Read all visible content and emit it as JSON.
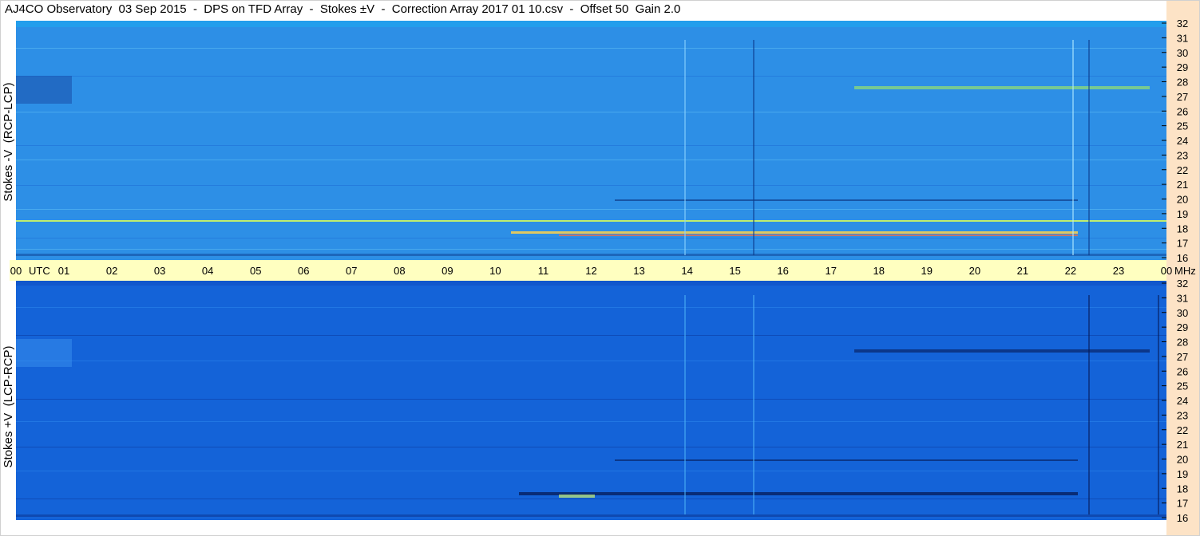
{
  "title": "AJ4CO Observatory  03 Sep 2015  -  DPS on TFD Array  -  Stokes ±V  -  Correction Array 2017 01 10.csv  -  Offset 50  Gain 2.0",
  "colors": {
    "top_panel": "#2d8fe6",
    "bottom_panel": "#1463d8",
    "time_axis_band": "#ffffc0",
    "freq_axis_band": "#fde3c6"
  },
  "chart_data": [
    {
      "type": "heatmap",
      "panel": "top",
      "ylabel": "Stokes -V  (RCP-LCP)",
      "x_ticks": [
        "00",
        "01",
        "02",
        "03",
        "04",
        "05",
        "06",
        "07",
        "08",
        "09",
        "10",
        "11",
        "12",
        "13",
        "14",
        "15",
        "16",
        "17",
        "18",
        "19",
        "20",
        "21",
        "22",
        "23",
        "00"
      ],
      "x_unit": "UTC",
      "xlim": [
        0,
        24
      ],
      "y_ticks": [
        32,
        31,
        30,
        29,
        28,
        27,
        26,
        25,
        24,
        23,
        22,
        21,
        20,
        19,
        18,
        17,
        16
      ],
      "y_unit": "MHz",
      "ylim": [
        16,
        32
      ]
    },
    {
      "type": "heatmap",
      "panel": "bottom",
      "ylabel": "Stokes +V  (LCP-RCP)",
      "x_ticks": [
        "00",
        "01",
        "02",
        "03",
        "04",
        "05",
        "06",
        "07",
        "08",
        "09",
        "10",
        "11",
        "12",
        "13",
        "14",
        "15",
        "16",
        "17",
        "18",
        "19",
        "20",
        "21",
        "22",
        "23",
        "00"
      ],
      "x_unit": "UTC",
      "xlim": [
        0,
        24
      ],
      "y_ticks": [
        32,
        31,
        30,
        29,
        28,
        27,
        26,
        25,
        24,
        23,
        22,
        21,
        20,
        19,
        18,
        17,
        16
      ],
      "y_unit": "MHz",
      "ylim": [
        16,
        32
      ]
    }
  ]
}
